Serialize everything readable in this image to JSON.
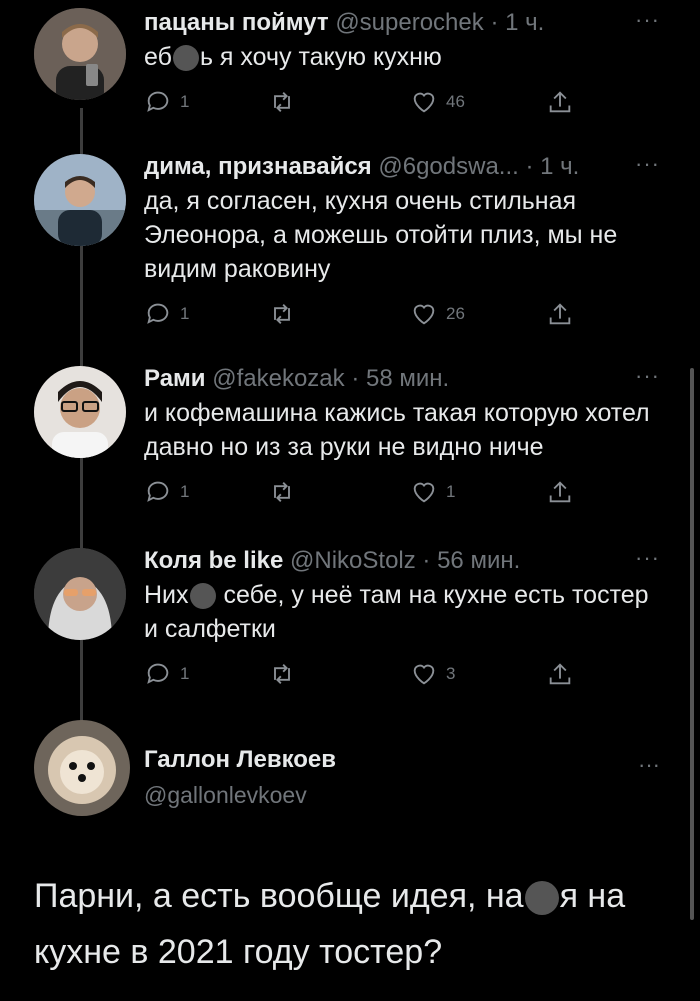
{
  "tweets": [
    {
      "name": "пацаны поймут",
      "handle": "@superochek",
      "time": "· 1 ч.",
      "text_before": "еб",
      "text_after": "ь я хочу такую кухню",
      "reply_count": "1",
      "retweet_count": "",
      "like_count": "46"
    },
    {
      "name": "дима, признавайся",
      "handle": "@6godswa...",
      "time": "· 1 ч.",
      "text": "да, я согласен, кухня очень стильная Элеонора, а можешь отойти плиз, мы не видим раковину",
      "reply_count": "1",
      "retweet_count": "",
      "like_count": "26"
    },
    {
      "name": "Рами",
      "handle": "@fakekozak",
      "time": "· 58 мин.",
      "text": "и кофемашина кажись такая которую хотел давно но из за руки не видно ниче",
      "reply_count": "1",
      "retweet_count": "",
      "like_count": "1"
    },
    {
      "name": "Коля be like",
      "handle": "@NikoStolz",
      "time": "· 56 мин.",
      "text_before": "Них",
      "text_after": " себе, у неё там на кухне есть тостер и салфетки",
      "reply_count": "1",
      "retweet_count": "",
      "like_count": "3"
    }
  ],
  "main_tweet": {
    "name": "Галлон Левкоев",
    "handle": "@gallonlevkoev",
    "text_before": "Парни, а есть вообще идея, на",
    "text_after": "я на кухне в 2021 году тостер?"
  },
  "more_label": "···"
}
